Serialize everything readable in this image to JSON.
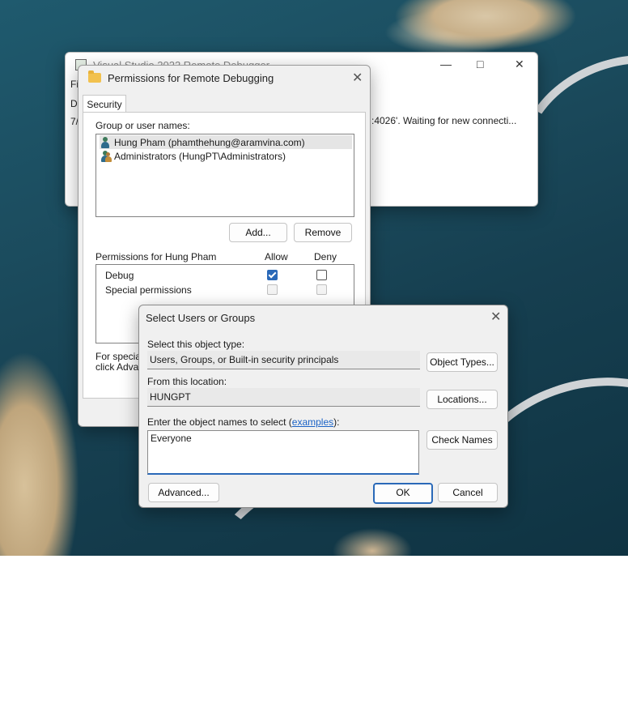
{
  "debugger_window": {
    "title": "Visual Studio 2022 Remote Debugger",
    "menu_fragment": "Fi",
    "row_fragment_1": "Da",
    "row_fragment_2": "7/",
    "log_text": ":4026'. Waiting for new connecti...",
    "minimize_glyph": "—",
    "maximize_glyph": "□",
    "close_glyph": "✕"
  },
  "permissions_dialog": {
    "title": "Permissions for Remote Debugging",
    "close_glyph": "✕",
    "tab_label": "Security",
    "group_label": "Group or user names:",
    "principals": [
      {
        "name": "Hung Pham (phamthehung@aramvina.com)",
        "icon": "user-icon",
        "selected": true
      },
      {
        "name": "Administrators (HungPT\\Administrators)",
        "icon": "group-icon",
        "selected": false
      }
    ],
    "add_label": "Add...",
    "remove_label": "Remove",
    "permissions_for_label": "Permissions for Hung Pham",
    "allow_header": "Allow",
    "deny_header": "Deny",
    "permissions": [
      {
        "name": "Debug",
        "allow": true,
        "deny": false,
        "enabled": true
      },
      {
        "name": "Special permissions",
        "allow": false,
        "deny": false,
        "enabled": false
      }
    ],
    "footer_line_1": "For special",
    "footer_line_2": "click Advan"
  },
  "select_dialog": {
    "title": "Select Users or Groups",
    "close_glyph": "✕",
    "object_type_label": "Select this object type:",
    "object_type_value": "Users, Groups, or Built-in security principals",
    "object_types_button": "Object Types...",
    "location_label": "From this location:",
    "location_value": "HUNGPT",
    "locations_button": "Locations...",
    "enter_label_prefix": "Enter the object names to select (",
    "enter_label_link": "examples",
    "enter_label_suffix": "):",
    "names_value": "Everyone",
    "check_names_button": "Check Names",
    "advanced_button": "Advanced...",
    "ok_button": "OK",
    "cancel_button": "Cancel"
  }
}
